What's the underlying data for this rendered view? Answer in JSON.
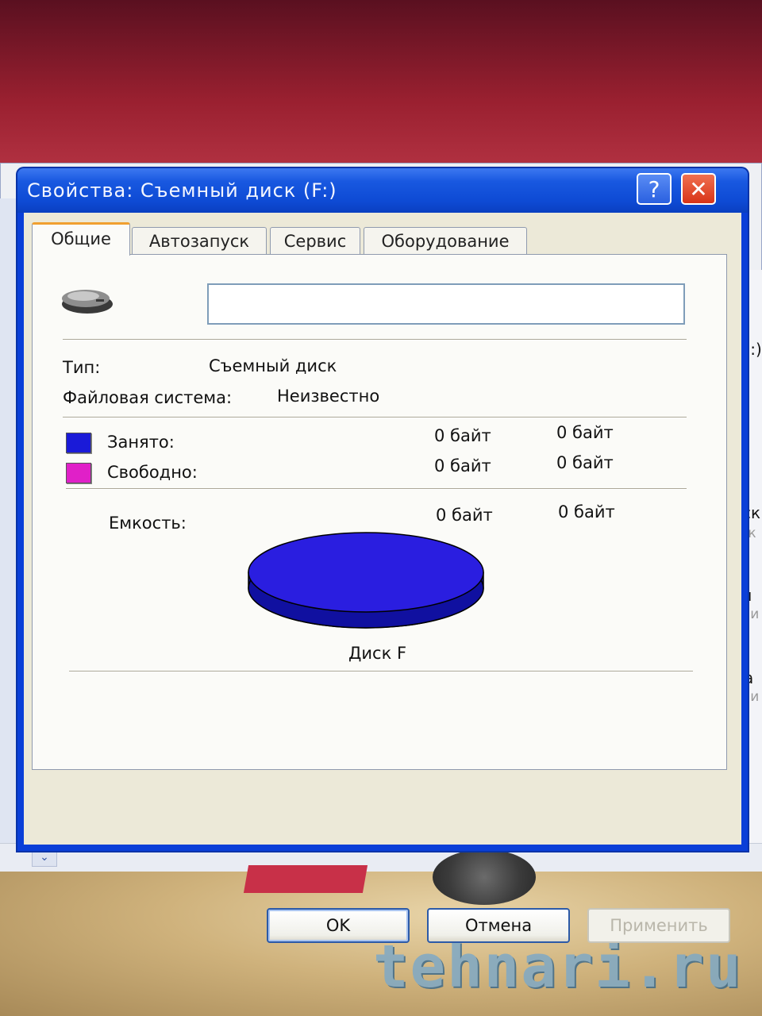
{
  "dialog": {
    "title": "Свойства: Съемный диск (F:)",
    "help_button": "?",
    "close_button": "✕"
  },
  "tabs": [
    {
      "label": "Общие",
      "active": true
    },
    {
      "label": "Автозапуск",
      "active": false
    },
    {
      "label": "Сервис",
      "active": false
    },
    {
      "label": "Оборудование",
      "active": false
    }
  ],
  "general": {
    "drive_icon": "removable-drive-icon",
    "volume_label_value": "",
    "type_label": "Тип:",
    "type_value": "Съемный диск",
    "fs_label": "Файловая система:",
    "fs_value": "Неизвестно",
    "used": {
      "label": "Занято:",
      "bytes": "0 байт",
      "size": "0 байт",
      "color": "#1a1ad8"
    },
    "free": {
      "label": "Свободно:",
      "bytes": "0 байт",
      "size": "0 байт",
      "color": "#e020c8"
    },
    "capacity": {
      "label": "Емкость:",
      "bytes": "0 байт",
      "size": "0 байт"
    },
    "disk_caption": "Диск F"
  },
  "buttons": {
    "ok": "OK",
    "cancel": "Отмена",
    "apply": "Применить"
  },
  "background": {
    "right_items": [
      "(G:)",
      "иск",
      "иск",
      "ен",
      "ами",
      "На",
      "ами"
    ],
    "watermark": "tehnari.ru",
    "scroll_arrow": "⌄"
  }
}
